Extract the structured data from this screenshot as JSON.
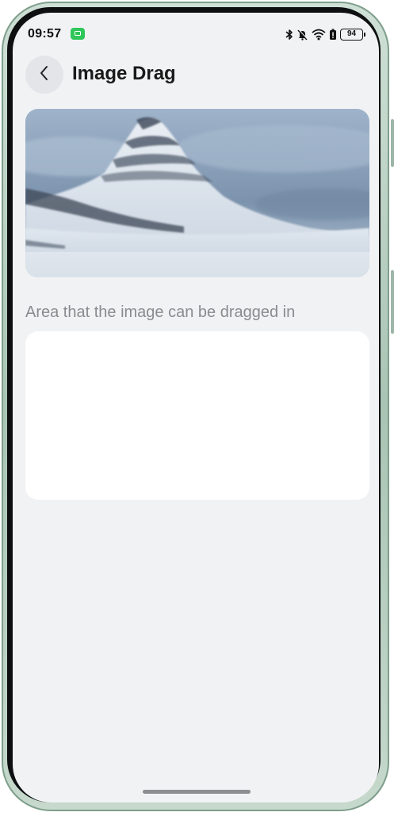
{
  "status_bar": {
    "time": "09:57",
    "battery_level": "94",
    "icons": [
      "notification-app-icon",
      "bluetooth-icon",
      "mute-icon",
      "wifi-icon",
      "battery-saver-icon",
      "battery-icon"
    ]
  },
  "header": {
    "title": "Image Drag",
    "back_icon": "chevron-left-icon"
  },
  "content": {
    "image_alt": "Snow-covered mountain",
    "drop_area_label": "Area that the image can be dragged in"
  },
  "colors": {
    "background": "#f1f2f4",
    "notification_green": "#2fc65a",
    "label_gray": "#8a8b8e"
  }
}
